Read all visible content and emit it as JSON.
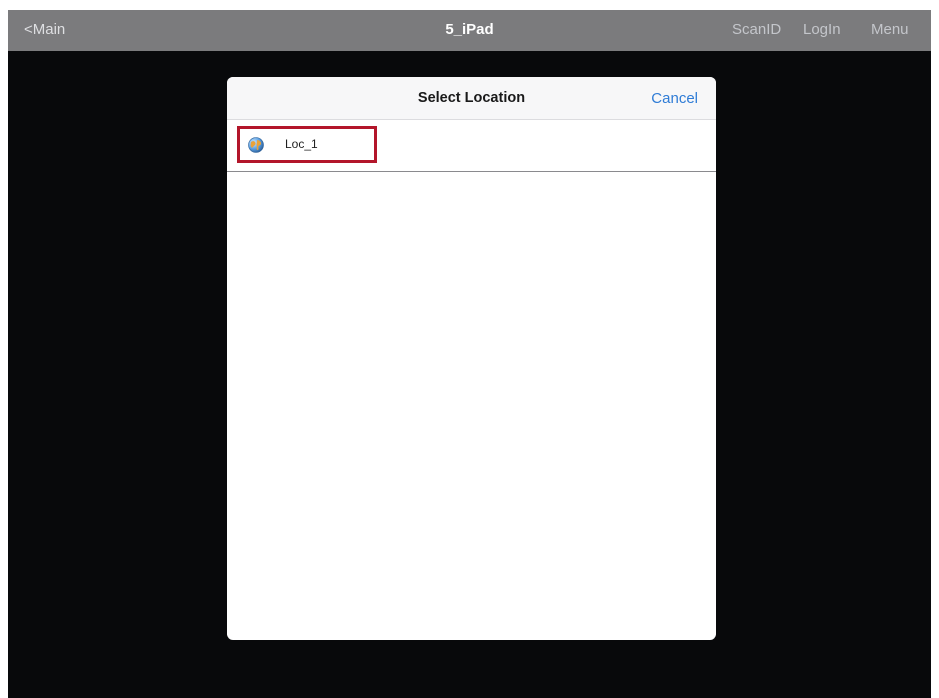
{
  "navbar": {
    "back_label": "<Main",
    "title": "5_iPad",
    "scanid_label": "ScanID",
    "login_label": "LogIn",
    "menu_label": "Menu"
  },
  "modal": {
    "title": "Select Location",
    "cancel_label": "Cancel",
    "items": [
      {
        "label": "Loc_1",
        "icon": "globe-icon"
      }
    ]
  },
  "colors": {
    "accent": "#2f7cd6",
    "highlight": "#b3162a",
    "navbar_bg": "#7b7b7d",
    "screen_bg": "#08090b"
  }
}
